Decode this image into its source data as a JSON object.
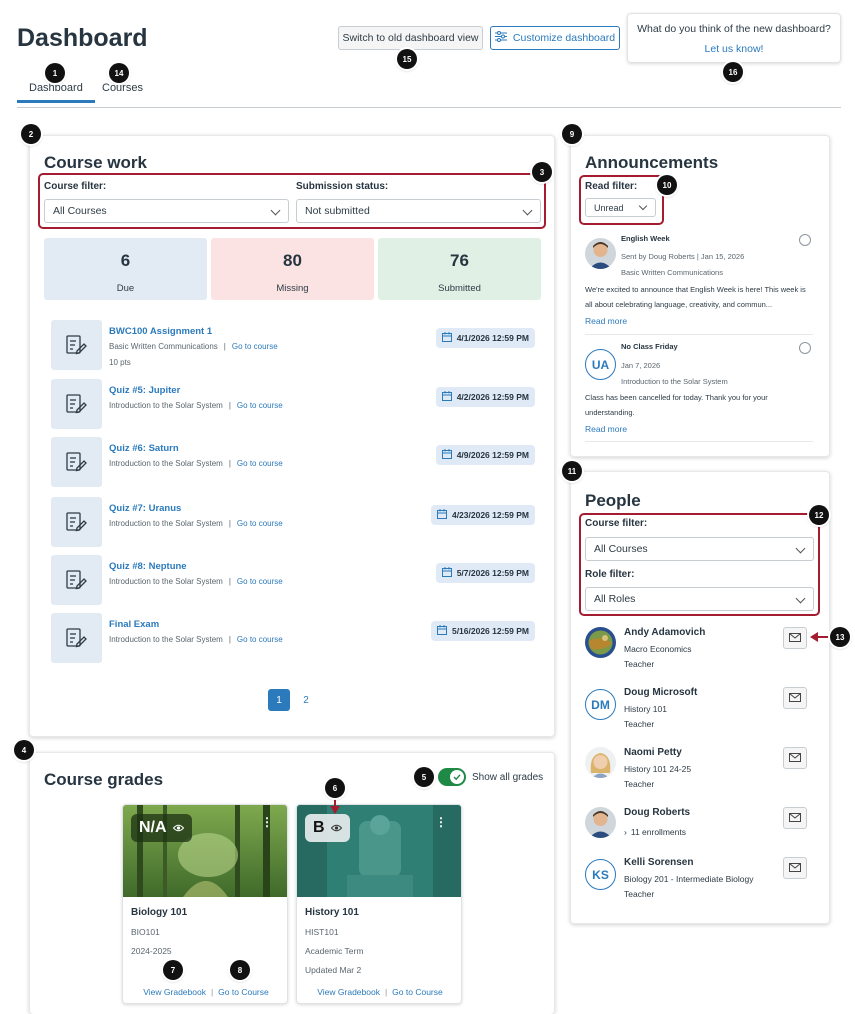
{
  "header": {
    "title": "Dashboard",
    "switch_old_label": "Switch to old dashboard view",
    "customize_label": "Customize dashboard",
    "feedback_question": "What do you think of the new dashboard?",
    "feedback_link": "Let us know!"
  },
  "tabs": [
    {
      "label": "Dashboard",
      "active": true
    },
    {
      "label": "Courses",
      "active": false
    }
  ],
  "callouts": [
    "1",
    "2",
    "3",
    "4",
    "5",
    "6",
    "7",
    "8",
    "9",
    "10",
    "11",
    "12",
    "13",
    "14",
    "15",
    "16"
  ],
  "course_work": {
    "title": "Course work",
    "course_filter_label": "Course filter:",
    "course_filter_value": "All Courses",
    "submission_label": "Submission status:",
    "submission_value": "Not submitted",
    "stats": [
      {
        "count": "6",
        "label": "Due",
        "color": "#e2ebf4"
      },
      {
        "count": "80",
        "label": "Missing",
        "color": "#fbe3e4"
      },
      {
        "count": "76",
        "label": "Submitted",
        "color": "#e1f0e5"
      }
    ],
    "items": [
      {
        "title": "BWC100 Assignment 1",
        "course": "Basic Written Communications",
        "link": "Go to course",
        "pts": "10 pts",
        "date": "4/1/2026 12:59 PM"
      },
      {
        "title": "Quiz #5: Jupiter",
        "course": "Introduction to the Solar System",
        "link": "Go to course",
        "pts": "",
        "date": "4/2/2026 12:59 PM"
      },
      {
        "title": "Quiz #6: Saturn",
        "course": "Introduction to the Solar System",
        "link": "Go to course",
        "pts": "",
        "date": "4/9/2026 12:59 PM"
      },
      {
        "title": "Quiz #7: Uranus",
        "course": "Introduction to the Solar System",
        "link": "Go to course",
        "pts": "",
        "date": "4/23/2026 12:59 PM"
      },
      {
        "title": "Quiz #8: Neptune",
        "course": "Introduction to the Solar System",
        "link": "Go to course",
        "pts": "",
        "date": "5/7/2026 12:59 PM"
      },
      {
        "title": "Final Exam",
        "course": "Introduction to the Solar System",
        "link": "Go to course",
        "pts": "",
        "date": "5/16/2026 12:59 PM"
      }
    ],
    "pages": [
      "1",
      "2"
    ]
  },
  "course_grades": {
    "title": "Course grades",
    "toggle_label": "Show all grades",
    "cards": [
      {
        "grade": "N/A",
        "name": "Biology 101",
        "code": "BIO101",
        "term": "2024-2025",
        "updated": "",
        "gradebook": "View Gradebook",
        "goto": "Go to Course"
      },
      {
        "grade": "B",
        "name": "History 101",
        "code": "HIST101",
        "term": "Academic Term",
        "updated": "Updated Mar 2",
        "gradebook": "View Gradebook",
        "goto": "Go to Course"
      }
    ]
  },
  "announcements": {
    "title": "Announcements",
    "read_filter_label": "Read filter:",
    "read_filter_value": "Unread",
    "items": [
      {
        "title": "English Week",
        "meta": "Sent by Doug Roberts | Jan 15, 2026",
        "course": "Basic Written Communications",
        "body": "We're excited to announce that English Week is here! This week is all about celebrating language, creativity, and commun...",
        "more": "Read more",
        "avatar": ""
      },
      {
        "title": "No Class Friday",
        "meta": "Jan 7, 2026",
        "course": "Introduction to the Solar System",
        "body": "Class has been cancelled for today. Thank you for your understanding.",
        "more": "Read more",
        "avatar": "UA"
      }
    ]
  },
  "people": {
    "title": "People",
    "course_filter_label": "Course filter:",
    "course_filter_value": "All Courses",
    "role_filter_label": "Role filter:",
    "role_filter_value": "All Roles",
    "list": [
      {
        "name": "Andy Adamovich",
        "line1": "Macro Economics",
        "line2": "Teacher",
        "initials": ""
      },
      {
        "name": "Doug Microsoft",
        "line1": "History 101",
        "line2": "Teacher",
        "initials": "DM"
      },
      {
        "name": "Naomi Petty",
        "line1": "History 101 24-25",
        "line2": "Teacher",
        "initials": ""
      },
      {
        "name": "Doug Roberts",
        "line1": "11 enrollments",
        "line2": "",
        "initials": ""
      },
      {
        "name": "Kelli Sorensen",
        "line1": "Biology 201 - Intermediate Biology",
        "line2": "Teacher",
        "initials": "KS"
      }
    ]
  }
}
